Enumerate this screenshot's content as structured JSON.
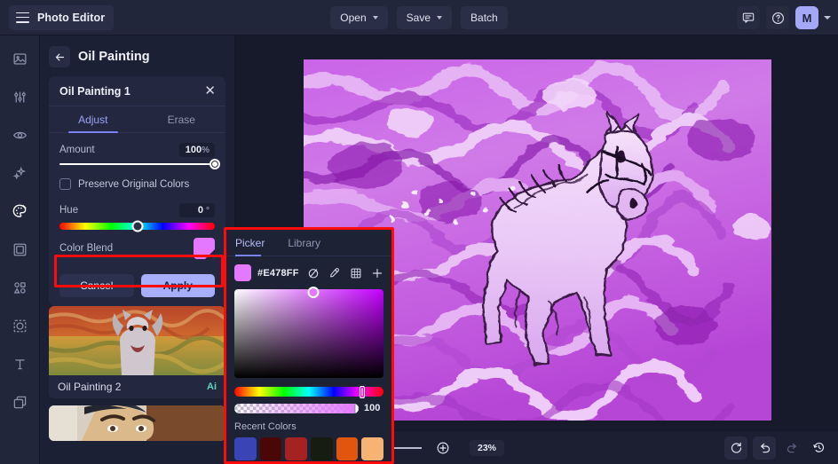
{
  "app": {
    "name": "Photo Editor",
    "menu_icon": "hamburger-icon"
  },
  "topbar": {
    "open_label": "Open",
    "save_label": "Save",
    "batch_label": "Batch",
    "feedback_icon": "chat-bubble-icon",
    "help_icon": "question-circle-icon",
    "avatar_initial": "M",
    "avatar_color": "#a5a7f7"
  },
  "rail": {
    "items": [
      {
        "icon": "image-icon",
        "active": false
      },
      {
        "icon": "sliders-adjust-icon",
        "active": false
      },
      {
        "icon": "eye-retouch-icon",
        "active": false
      },
      {
        "icon": "sparkles-effects-icon",
        "active": false
      },
      {
        "icon": "palette-icon",
        "active": true
      },
      {
        "icon": "frame-icon",
        "active": false
      },
      {
        "icon": "shapes-icon",
        "active": false
      },
      {
        "icon": "mask-cutout-icon",
        "active": false
      },
      {
        "icon": "text-icon",
        "active": false
      },
      {
        "icon": "layers-icon",
        "active": false
      }
    ]
  },
  "panel": {
    "back_icon": "arrow-left-icon",
    "title": "Oil Painting",
    "card": {
      "title": "Oil Painting 1",
      "close_icon": "close-icon",
      "tabs": [
        {
          "label": "Adjust",
          "active": true
        },
        {
          "label": "Erase",
          "active": false
        }
      ],
      "amount": {
        "label": "Amount",
        "value": "100",
        "unit": "%",
        "slider_pct": 100
      },
      "preserve": {
        "label": "Preserve Original Colors",
        "checked": false
      },
      "hue": {
        "label": "Hue",
        "value": "0",
        "unit": "°",
        "slider_pct": 50
      },
      "color_blend": {
        "label": "Color Blend",
        "swatch": "#e478ff"
      },
      "cancel_label": "Cancel",
      "apply_label": "Apply"
    },
    "presets": [
      {
        "name": "Oil Painting 2",
        "badge": "Ai"
      }
    ]
  },
  "picker": {
    "tabs": [
      {
        "label": "Picker",
        "active": true
      },
      {
        "label": "Library",
        "active": false
      }
    ],
    "hex": "#E478FF",
    "swatch": "#e478ff",
    "icons": [
      {
        "name": "no-color-icon"
      },
      {
        "name": "eyedropper-icon"
      },
      {
        "name": "palette-grid-icon"
      },
      {
        "name": "plus-icon"
      }
    ],
    "alpha_value": "100",
    "recent_label": "Recent Colors",
    "recent_colors": [
      "#3a44b4",
      "#4b0606",
      "#a52222",
      "#161c12",
      "#e2550f",
      "#f6b374"
    ]
  },
  "bottombar": {
    "fit_screen_icon": "fit-screen-icon",
    "shrink_icon": "shrink-to-fit-icon",
    "zoom_out_icon": "zoom-out-icon",
    "zoom_in_icon": "zoom-in-icon",
    "zoom_value": "23%",
    "zoom_slider_pct": 4,
    "reset_icon": "reset-rotate-icon",
    "undo_icon": "undo-icon",
    "redo_icon": "redo-icon",
    "history_icon": "history-clock-icon"
  },
  "canvas": {
    "artwork_description": "Oil painting of a white horse in a purple-tinted meadow"
  },
  "highlights": {
    "color_blend_box": "#ff0b0b",
    "picker_box": "#ff0b0b"
  }
}
